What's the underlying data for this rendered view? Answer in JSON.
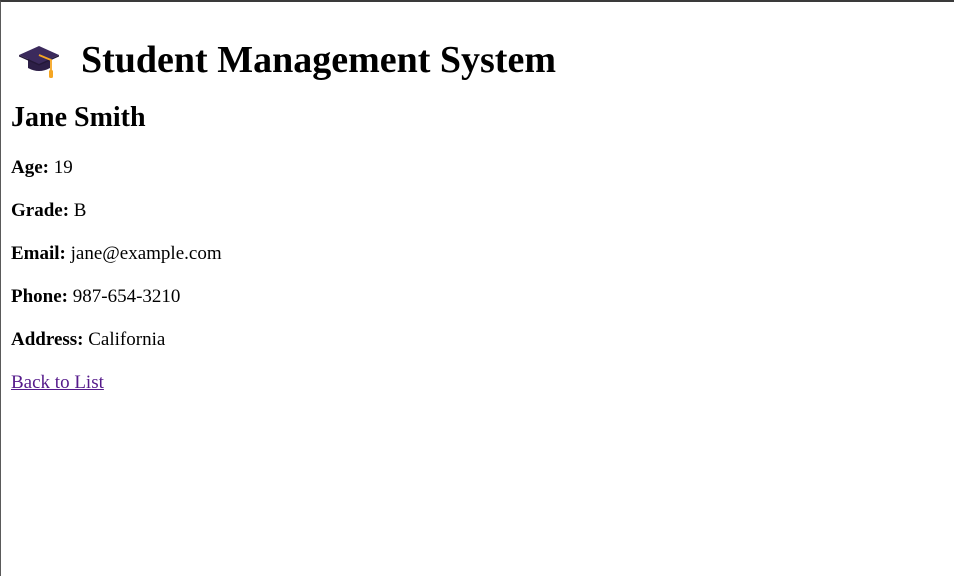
{
  "header": {
    "title": "Student Management System",
    "icon": "graduation-cap-icon"
  },
  "student": {
    "name": "Jane Smith",
    "fields": {
      "age": {
        "label": "Age:",
        "value": "19"
      },
      "grade": {
        "label": "Grade:",
        "value": "B"
      },
      "email": {
        "label": "Email:",
        "value": "jane@example.com"
      },
      "phone": {
        "label": "Phone:",
        "value": "987-654-3210"
      },
      "address": {
        "label": "Address:",
        "value": "California"
      }
    }
  },
  "nav": {
    "back_label": "Back to List"
  },
  "colors": {
    "visited_link": "#551a8b",
    "cap_body": "#3b2a5c",
    "tassel": "#f5a623"
  }
}
